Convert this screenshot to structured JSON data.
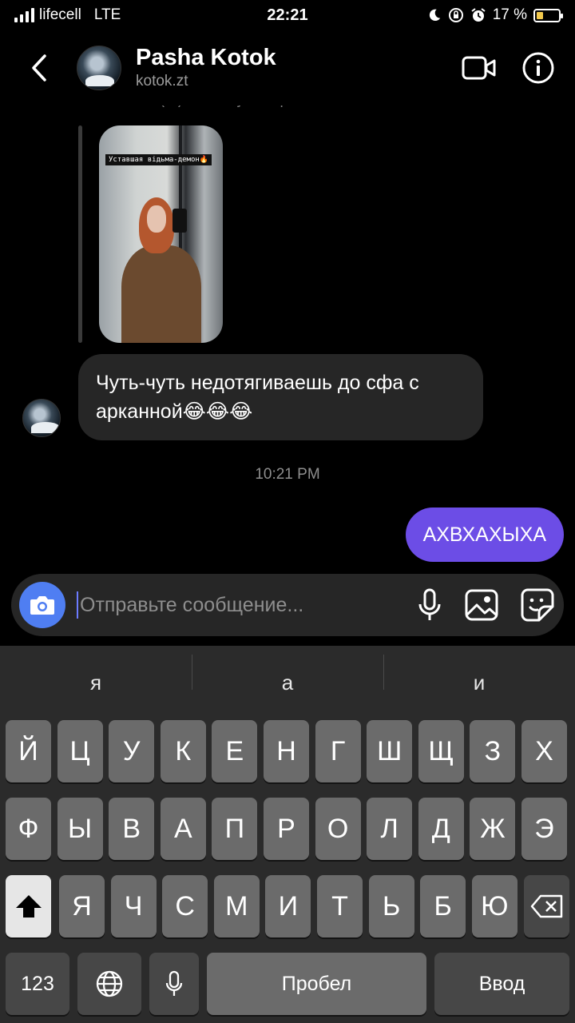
{
  "status_bar": {
    "carrier": "lifecell",
    "network": "LTE",
    "time": "22:21",
    "battery_text": "17 %",
    "battery_level": 0.17
  },
  "header": {
    "name": "Pasha Kotok",
    "username": "kotok.zt"
  },
  "chat": {
    "reply_caption": "Ответил(-а) на вашу историю",
    "story_label": "Уставшая відьма-демон🔥",
    "incoming_message": "Чуть-чуть недотягиваешь до сфа с арканной😂😂😂",
    "timestamp": "10:21 PM",
    "outgoing_message": "АХВХАХЫХА"
  },
  "composer": {
    "placeholder": "Отправьте сообщение..."
  },
  "keyboard": {
    "suggestions": [
      "я",
      "а",
      "и"
    ],
    "row1": [
      "Й",
      "Ц",
      "У",
      "К",
      "Е",
      "Н",
      "Г",
      "Ш",
      "Щ",
      "З",
      "Х"
    ],
    "row2": [
      "Ф",
      "Ы",
      "В",
      "А",
      "П",
      "Р",
      "О",
      "Л",
      "Д",
      "Ж",
      "Э"
    ],
    "row3": [
      "Я",
      "Ч",
      "С",
      "М",
      "И",
      "Т",
      "Ь",
      "Б",
      "Ю"
    ],
    "numbers_label": "123",
    "space_label": "Пробел",
    "return_label": "Ввод"
  },
  "colors": {
    "accent": "#6c4de6",
    "camera": "#4f7ef2",
    "bubble_in": "#262626"
  }
}
